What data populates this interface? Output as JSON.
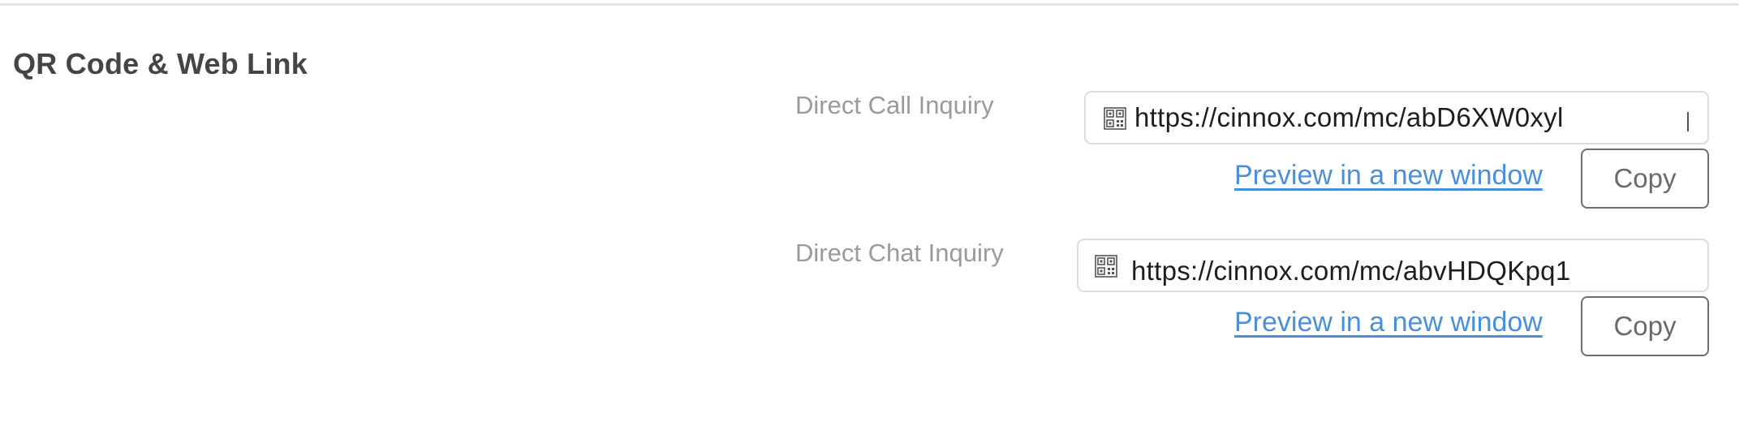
{
  "section": {
    "title": "QR Code & Web Link"
  },
  "links": [
    {
      "label": "Direct Call Inquiry",
      "url": "https://cinnox.com/mc/abD6XW0xyl",
      "preview_label": "Preview in a new window",
      "copy_label": "Copy",
      "icon": "qr-code-icon"
    },
    {
      "label": "Direct Chat Inquiry",
      "url": "https://cinnox.com/mc/abvHDQKpq1",
      "preview_label": "Preview in a new window",
      "copy_label": "Copy",
      "icon": "qr-code-icon"
    }
  ],
  "colors": {
    "title": "#454545",
    "label": "#9a9a9a",
    "link": "#4a8fdc",
    "border": "#dcdcdc",
    "button_border": "#6f6f6f"
  }
}
